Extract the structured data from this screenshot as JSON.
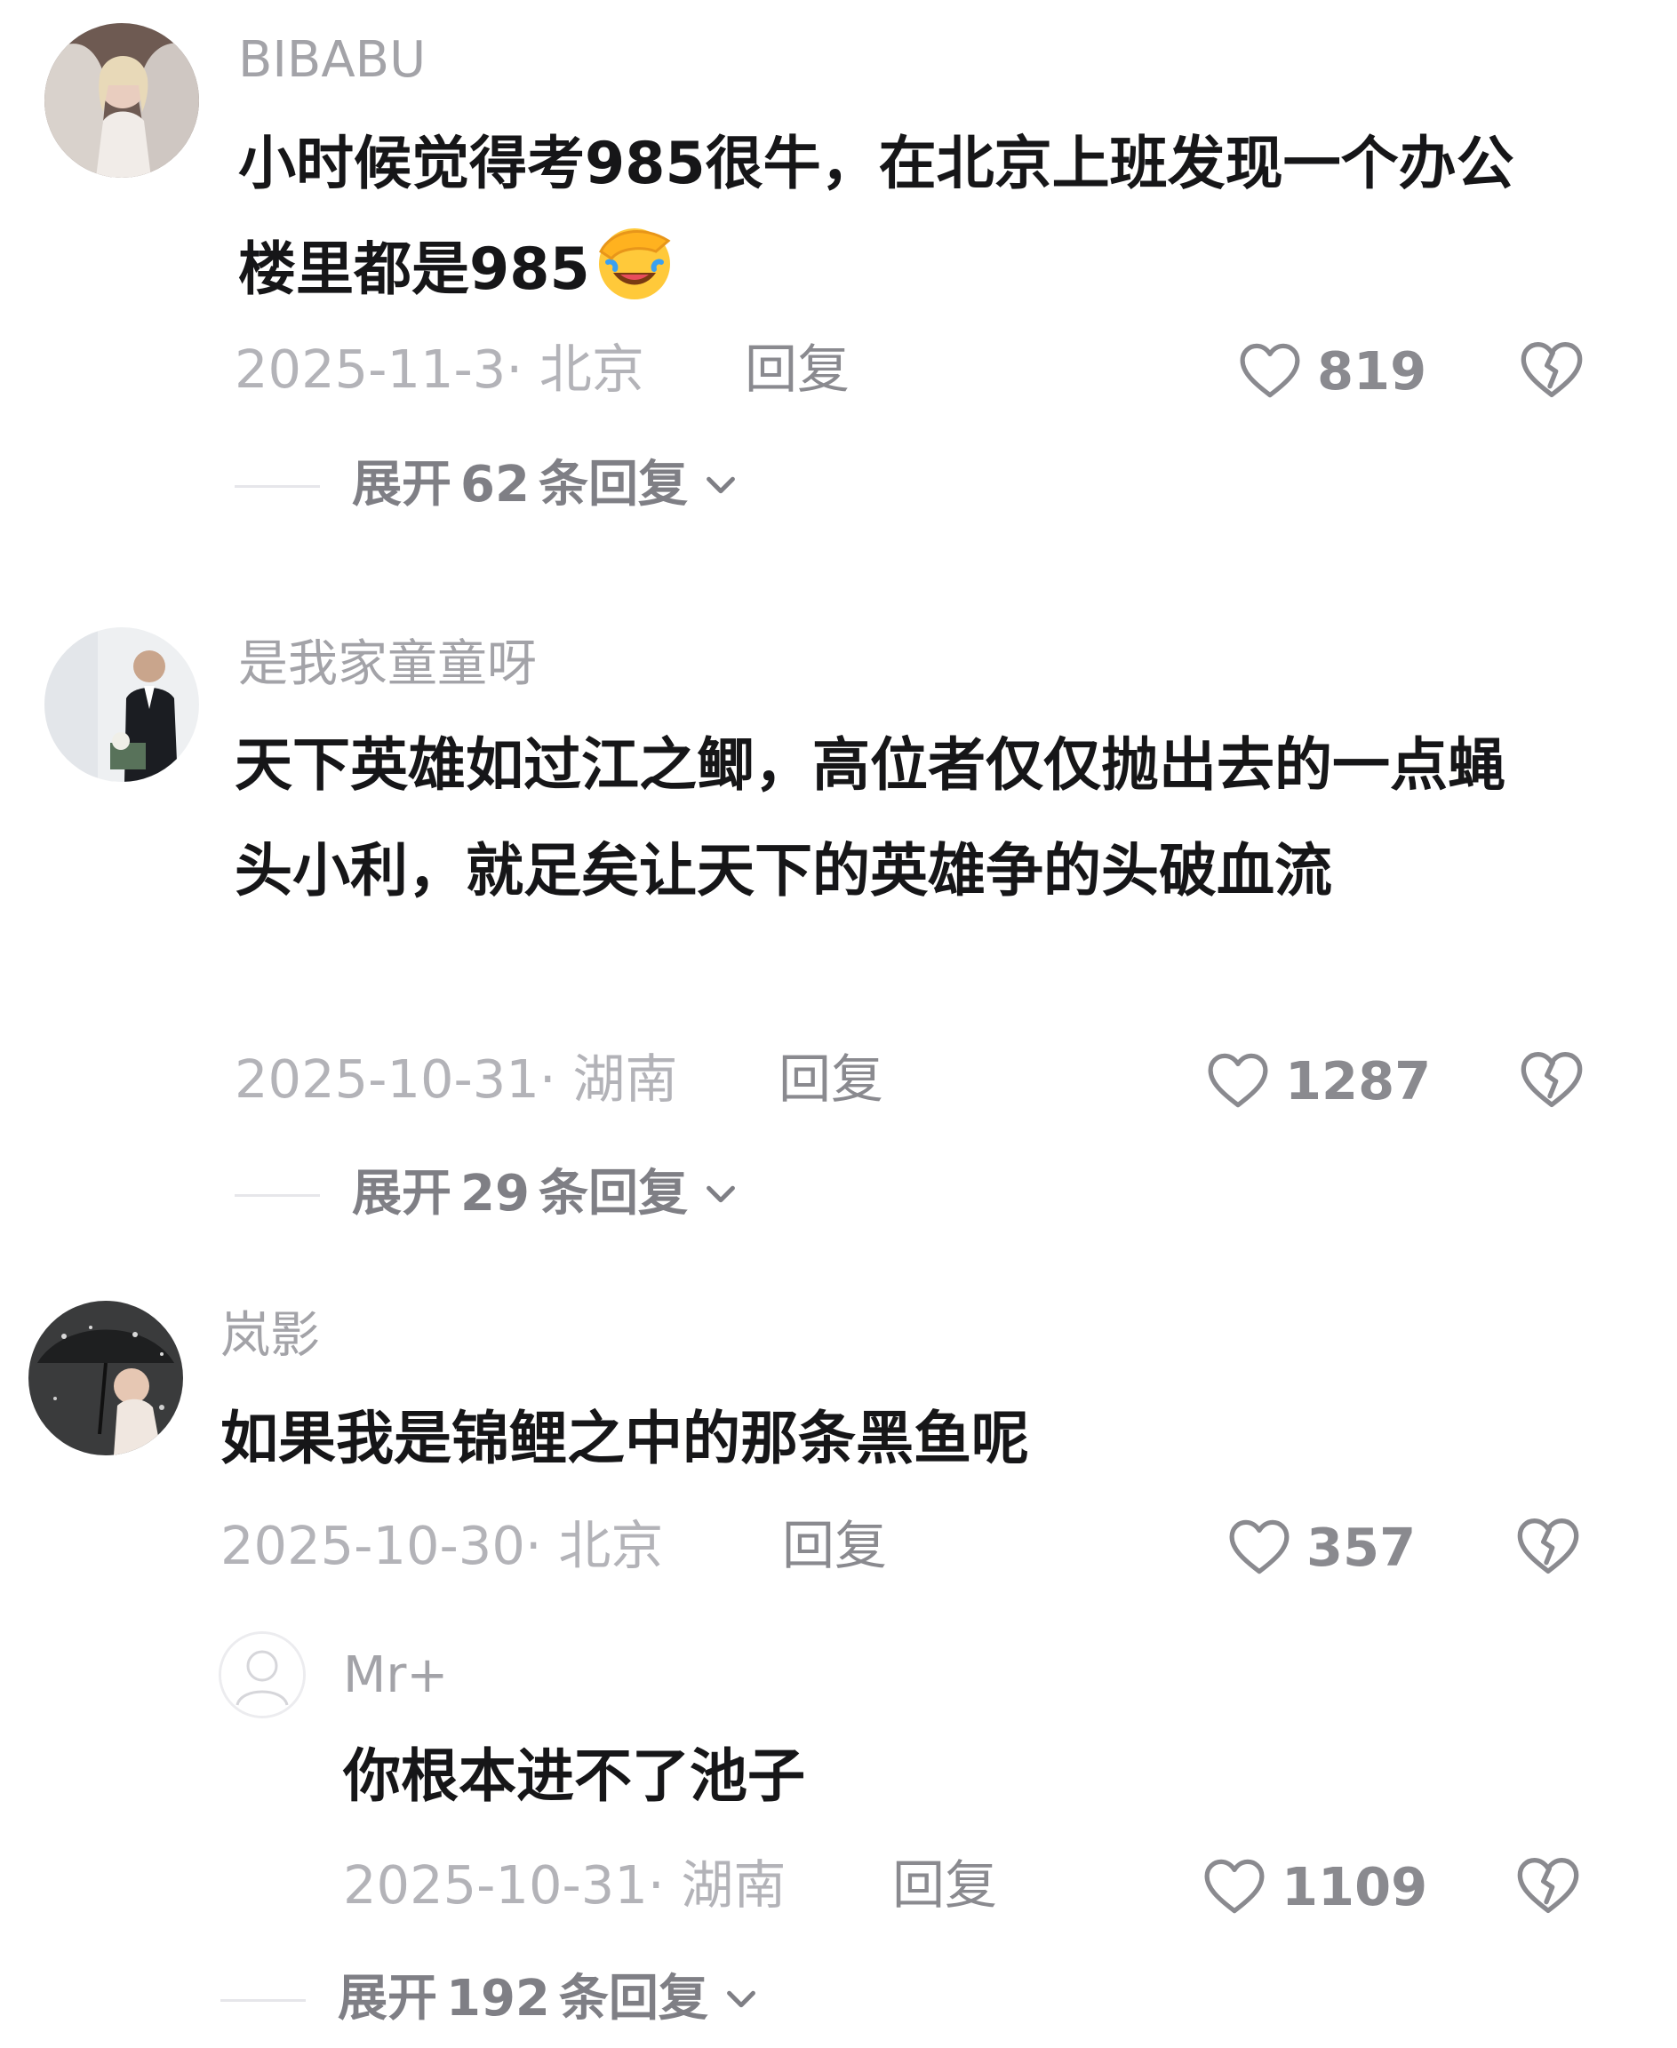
{
  "comments": [
    {
      "username": "BIBABU",
      "text": "小时候觉得考985很牛，在北京上班发现一个办公楼里都是985",
      "emoji": "facepalm-laughing-emoji",
      "meta": "2025-11-3· 北京",
      "reply_label": "回复",
      "likes": "819",
      "expand": {
        "prefix": "展开",
        "count": "62",
        "suffix": "条回复"
      }
    },
    {
      "username": "是我家童童呀",
      "text": "天下英雄如过江之鲫，高位者仅仅抛出去的一点蝇头小利，就足矣让天下的英雄争的头破血流",
      "meta": "2025-10-31· 湖南",
      "reply_label": "回复",
      "likes": "1287",
      "expand": {
        "prefix": "展开",
        "count": "29",
        "suffix": "条回复"
      }
    },
    {
      "username": "岚影",
      "text": "如果我是锦鲤之中的那条黑鱼呢",
      "meta": "2025-10-30· 北京",
      "reply_label": "回复",
      "likes": "357",
      "reply": {
        "username": "Mr+",
        "text": "你根本进不了池子",
        "meta": "2025-10-31· 湖南",
        "reply_label": "回复",
        "likes": "1109"
      },
      "expand": {
        "prefix": "展开",
        "count": "192",
        "suffix": "条回复"
      }
    }
  ],
  "icons": {
    "like": "heart-outline-icon",
    "dislike": "broken-heart-icon",
    "expand": "chevron-down-icon"
  },
  "colors": {
    "username": "#a3a3a8",
    "text": "#161618",
    "meta": "#b3b3b8",
    "action": "#8a8a8f"
  }
}
